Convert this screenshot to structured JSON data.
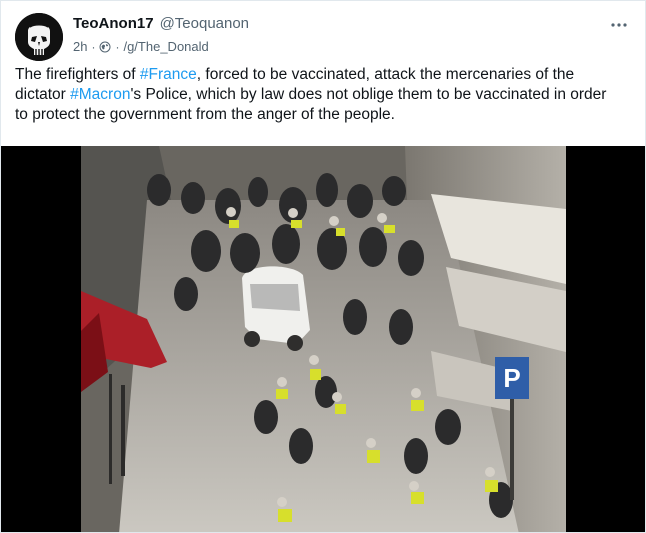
{
  "author": {
    "display_name": "TeoAnon17",
    "handle": "@Teoquanon",
    "avatar_icon": "punisher-skull-icon"
  },
  "meta": {
    "time": "2h",
    "separator": "·",
    "visibility_icon": "globe-icon",
    "group": "/g/The_Donald"
  },
  "menu": {
    "icon": "more-dots-icon"
  },
  "post": {
    "segments": [
      {
        "type": "text",
        "value": "The firefighters of "
      },
      {
        "type": "hashtag",
        "value": "#France"
      },
      {
        "type": "text",
        "value": ", forced to be vaccinated, attack the mercenaries of the dictator "
      },
      {
        "type": "hashtag",
        "value": "#Macron"
      },
      {
        "type": "text",
        "value": "'s Police, which by law does not oblige them to be vaccinated in order to protect the government from the anger of the people."
      }
    ]
  },
  "media": {
    "type": "video",
    "background": "#000000"
  },
  "colors": {
    "accent": "#1d9bf0",
    "text": "#0f1419",
    "muted": "#536471"
  }
}
